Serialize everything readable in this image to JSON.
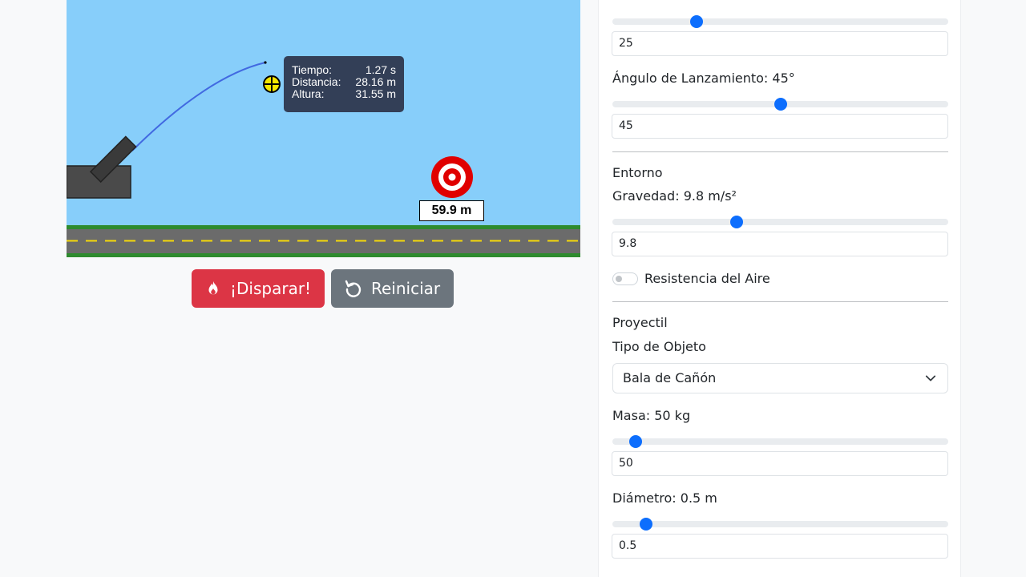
{
  "simulation": {
    "tooltip": {
      "time_label": "Tiempo:",
      "time_value": "1.27 s",
      "distance_label": "Distancia:",
      "distance_value": "28.16 m",
      "height_label": "Altura:",
      "height_value": "31.55 m"
    },
    "target_distance": "59.9 m",
    "colors": {
      "sky": "#87cefa",
      "road": "#6b6b6b",
      "grass": "#2e8b2e",
      "lane": "#f5d90a",
      "trajectory": "#4169e1",
      "cannon": "#4a4a4a",
      "target": "#e00000"
    }
  },
  "actions": {
    "fire_label": "¡Disparar!",
    "fire_icon": "fire-icon",
    "reset_label": "Reiniciar",
    "reset_icon": "reset-icon"
  },
  "panel": {
    "velocity": {
      "value": "25",
      "slider_fraction": 0.25
    },
    "angle": {
      "label": "Ángulo de Lanzamiento: 45°",
      "value": "45",
      "slider_fraction": 0.5
    },
    "environment": {
      "heading": "Entorno",
      "gravity_label": "Gravedad: 9.8 m/s²",
      "gravity_value": "9.8",
      "gravity_fraction": 0.37,
      "air_resistance_label": "Resistencia del Aire",
      "air_resistance_on": false
    },
    "projectile": {
      "heading": "Proyectil",
      "type_label": "Tipo de Objeto",
      "type_selected": "Bala de Cañón",
      "mass_label": "Masa: 50 kg",
      "mass_value": "50",
      "mass_fraction": 0.07,
      "diameter_label": "Diámetro: 0.5 m",
      "diameter_value": "0.5",
      "diameter_fraction": 0.1
    }
  }
}
